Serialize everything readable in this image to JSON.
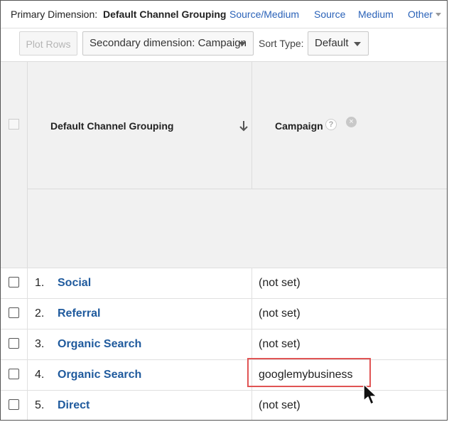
{
  "dimension_bar": {
    "label": "Primary Dimension:",
    "active": "Default Channel Grouping",
    "links": [
      "Source/Medium",
      "Source",
      "Medium"
    ],
    "other": "Other"
  },
  "toolbar": {
    "plot_rows": "Plot Rows",
    "secondary_dimension": "Secondary dimension: Campaign",
    "sort_type_label": "Sort Type:",
    "sort_type_value": "Default"
  },
  "table": {
    "headers": {
      "col1": "Default Channel Grouping",
      "col2": "Campaign",
      "help_glyph": "?",
      "remove_glyph": "×"
    },
    "rows": [
      {
        "num": "1.",
        "channel": "Social",
        "campaign": "(not set)"
      },
      {
        "num": "2.",
        "channel": "Referral",
        "campaign": "(not set)"
      },
      {
        "num": "3.",
        "channel": "Organic Search",
        "campaign": "(not set)"
      },
      {
        "num": "4.",
        "channel": "Organic Search",
        "campaign": "googlemybusiness"
      },
      {
        "num": "5.",
        "channel": "Direct",
        "campaign": "(not set)"
      }
    ]
  },
  "colors": {
    "link": "#2a62b8",
    "channel_text": "#1f5a9d",
    "highlight": "#e05454",
    "header_bg": "#f1f1f1"
  },
  "icons": [
    "sort-down-arrow-icon",
    "help-icon",
    "remove-icon",
    "mouse-pointer-icon"
  ]
}
